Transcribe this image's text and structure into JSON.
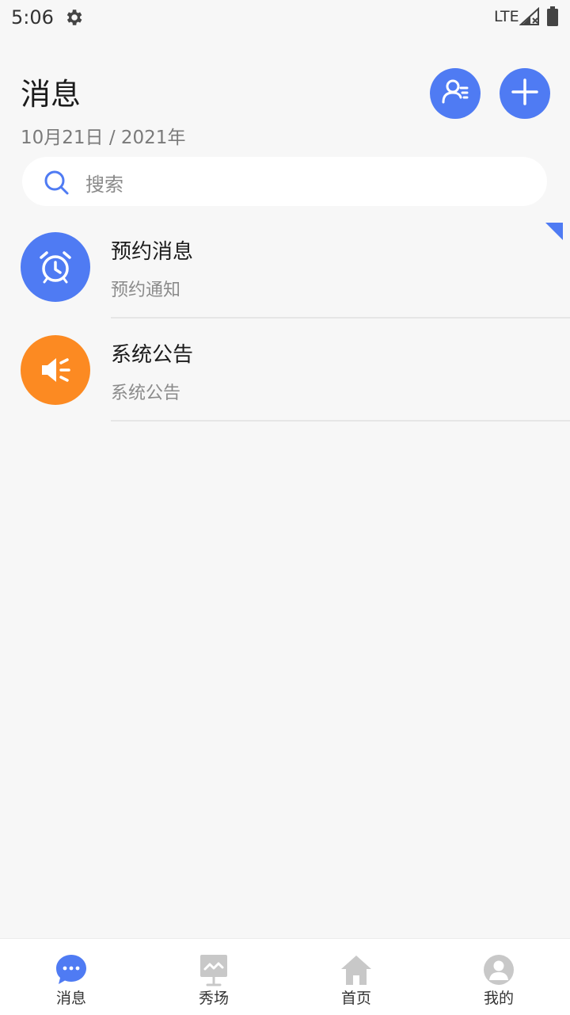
{
  "status_bar": {
    "time": "5:06",
    "network": "LTE"
  },
  "header": {
    "title": "消息",
    "date": "10月21日 / 2021年"
  },
  "search": {
    "placeholder": "搜索"
  },
  "messages": [
    {
      "title": "预约消息",
      "subtitle": "预约通知",
      "icon": "alarm-clock-icon",
      "color": "#4f7bf3"
    },
    {
      "title": "系统公告",
      "subtitle": "系统公告",
      "icon": "speaker-icon",
      "color": "#fc8a22"
    }
  ],
  "tabs": [
    {
      "label": "消息",
      "icon": "chat-bubble-icon",
      "active": true
    },
    {
      "label": "秀场",
      "icon": "presentation-board-icon",
      "active": false
    },
    {
      "label": "首页",
      "icon": "home-icon",
      "active": false
    },
    {
      "label": "我的",
      "icon": "profile-icon",
      "active": false
    }
  ],
  "colors": {
    "accent": "#4f7bf3",
    "orange": "#fc8a22",
    "background": "#f7f7f7",
    "inactive_icon": "#c8c8c8"
  }
}
